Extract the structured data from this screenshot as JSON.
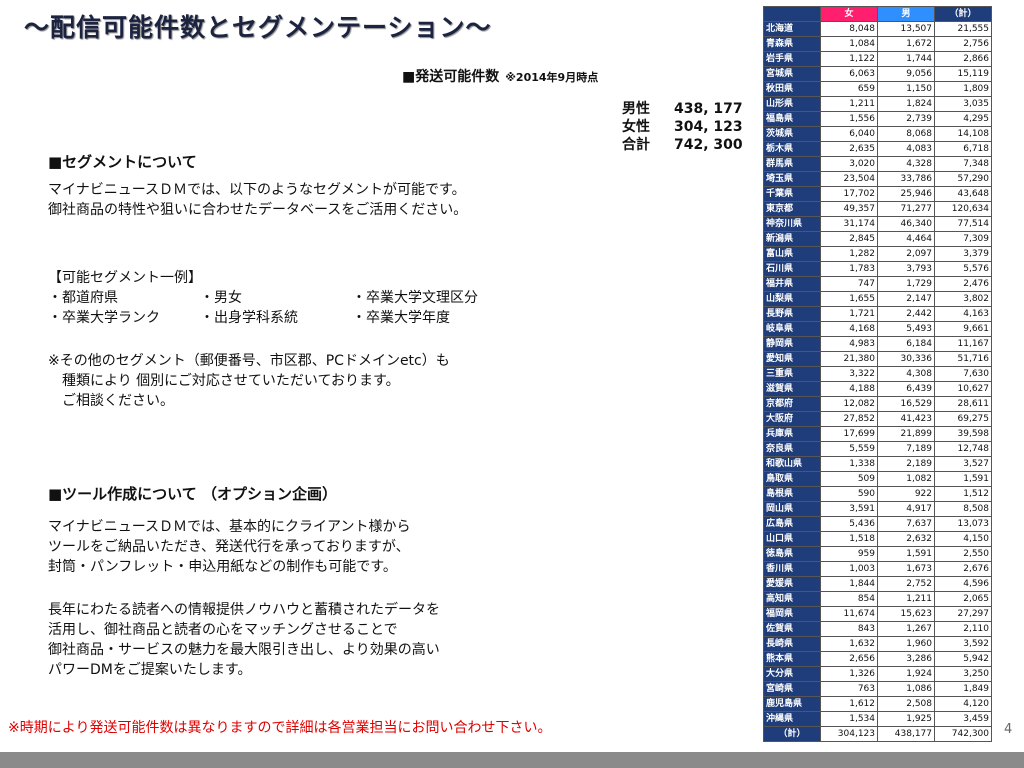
{
  "title": "〜配信可能件数とセグメンテーション〜",
  "send_count": {
    "title": "■発送可能件数",
    "as_of": "※2014年9月時点",
    "rows": [
      {
        "label": "男性",
        "value": "438, 177"
      },
      {
        "label": "女性",
        "value": "304, 123"
      },
      {
        "label": "合計",
        "value": "742, 300"
      }
    ]
  },
  "segment": {
    "heading": "■セグメントについて",
    "intro": [
      "マイナビニュースＤＭでは、以下のようなセグメントが可能です。",
      "御社商品の特性や狙いに合わせたデータベースをご活用ください。"
    ],
    "examples_heading": "【可能セグメント一例】",
    "examples": [
      [
        "・都道府県",
        "・男女",
        "・卒業大学文理区分"
      ],
      [
        "・卒業大学ランク",
        "・出身学科系統",
        "・卒業大学年度"
      ]
    ],
    "note": [
      "※その他のセグメント（郵便番号、市区郡、PCドメインetc）も",
      "種類により 個別にご対応させていただいております。",
      "ご相談ください。"
    ]
  },
  "tool": {
    "heading": "■ツール作成について （オプション企画）",
    "para1": [
      "マイナビニュースＤＭでは、基本的にクライアント様から",
      "ツールをご納品いただき、発送代行を承っておりますが、",
      "封筒・パンフレット・申込用紙などの制作も可能です。"
    ],
    "para2": [
      "長年にわたる読者への情報提供ノウハウと蓄積されたデータを",
      "活用し、御社商品と読者の心をマッチングさせることで",
      "御社商品・サービスの魅力を最大限引き出し、より効果の高い",
      "パワーDMをご提案いたします。"
    ]
  },
  "footnote": "※時期により発送可能件数は異なりますので詳細は各営業担当にお問い合わせ下さい。",
  "page_number": "4",
  "table": {
    "headers": [
      "",
      "女",
      "男",
      "（計）"
    ],
    "rows": [
      [
        "北海道",
        "8,048",
        "13,507",
        "21,555"
      ],
      [
        "青森県",
        "1,084",
        "1,672",
        "2,756"
      ],
      [
        "岩手県",
        "1,122",
        "1,744",
        "2,866"
      ],
      [
        "宮城県",
        "6,063",
        "9,056",
        "15,119"
      ],
      [
        "秋田県",
        "659",
        "1,150",
        "1,809"
      ],
      [
        "山形県",
        "1,211",
        "1,824",
        "3,035"
      ],
      [
        "福島県",
        "1,556",
        "2,739",
        "4,295"
      ],
      [
        "茨城県",
        "6,040",
        "8,068",
        "14,108"
      ],
      [
        "栃木県",
        "2,635",
        "4,083",
        "6,718"
      ],
      [
        "群馬県",
        "3,020",
        "4,328",
        "7,348"
      ],
      [
        "埼玉県",
        "23,504",
        "33,786",
        "57,290"
      ],
      [
        "千葉県",
        "17,702",
        "25,946",
        "43,648"
      ],
      [
        "東京都",
        "49,357",
        "71,277",
        "120,634"
      ],
      [
        "神奈川県",
        "31,174",
        "46,340",
        "77,514"
      ],
      [
        "新潟県",
        "2,845",
        "4,464",
        "7,309"
      ],
      [
        "富山県",
        "1,282",
        "2,097",
        "3,379"
      ],
      [
        "石川県",
        "1,783",
        "3,793",
        "5,576"
      ],
      [
        "福井県",
        "747",
        "1,729",
        "2,476"
      ],
      [
        "山梨県",
        "1,655",
        "2,147",
        "3,802"
      ],
      [
        "長野県",
        "1,721",
        "2,442",
        "4,163"
      ],
      [
        "岐阜県",
        "4,168",
        "5,493",
        "9,661"
      ],
      [
        "静岡県",
        "4,983",
        "6,184",
        "11,167"
      ],
      [
        "愛知県",
        "21,380",
        "30,336",
        "51,716"
      ],
      [
        "三重県",
        "3,322",
        "4,308",
        "7,630"
      ],
      [
        "滋賀県",
        "4,188",
        "6,439",
        "10,627"
      ],
      [
        "京都府",
        "12,082",
        "16,529",
        "28,611"
      ],
      [
        "大阪府",
        "27,852",
        "41,423",
        "69,275"
      ],
      [
        "兵庫県",
        "17,699",
        "21,899",
        "39,598"
      ],
      [
        "奈良県",
        "5,559",
        "7,189",
        "12,748"
      ],
      [
        "和歌山県",
        "1,338",
        "2,189",
        "3,527"
      ],
      [
        "鳥取県",
        "509",
        "1,082",
        "1,591"
      ],
      [
        "島根県",
        "590",
        "922",
        "1,512"
      ],
      [
        "岡山県",
        "3,591",
        "4,917",
        "8,508"
      ],
      [
        "広島県",
        "5,436",
        "7,637",
        "13,073"
      ],
      [
        "山口県",
        "1,518",
        "2,632",
        "4,150"
      ],
      [
        "徳島県",
        "959",
        "1,591",
        "2,550"
      ],
      [
        "香川県",
        "1,003",
        "1,673",
        "2,676"
      ],
      [
        "愛媛県",
        "1,844",
        "2,752",
        "4,596"
      ],
      [
        "高知県",
        "854",
        "1,211",
        "2,065"
      ],
      [
        "福岡県",
        "11,674",
        "15,623",
        "27,297"
      ],
      [
        "佐賀県",
        "843",
        "1,267",
        "2,110"
      ],
      [
        "長崎県",
        "1,632",
        "1,960",
        "3,592"
      ],
      [
        "熊本県",
        "2,656",
        "3,286",
        "5,942"
      ],
      [
        "大分県",
        "1,326",
        "1,924",
        "3,250"
      ],
      [
        "宮崎県",
        "763",
        "1,086",
        "1,849"
      ],
      [
        "鹿児島県",
        "1,612",
        "2,508",
        "4,120"
      ],
      [
        "沖縄県",
        "1,534",
        "1,925",
        "3,459"
      ]
    ],
    "total": [
      "（計）",
      "304,123",
      "438,177",
      "742,300"
    ]
  }
}
